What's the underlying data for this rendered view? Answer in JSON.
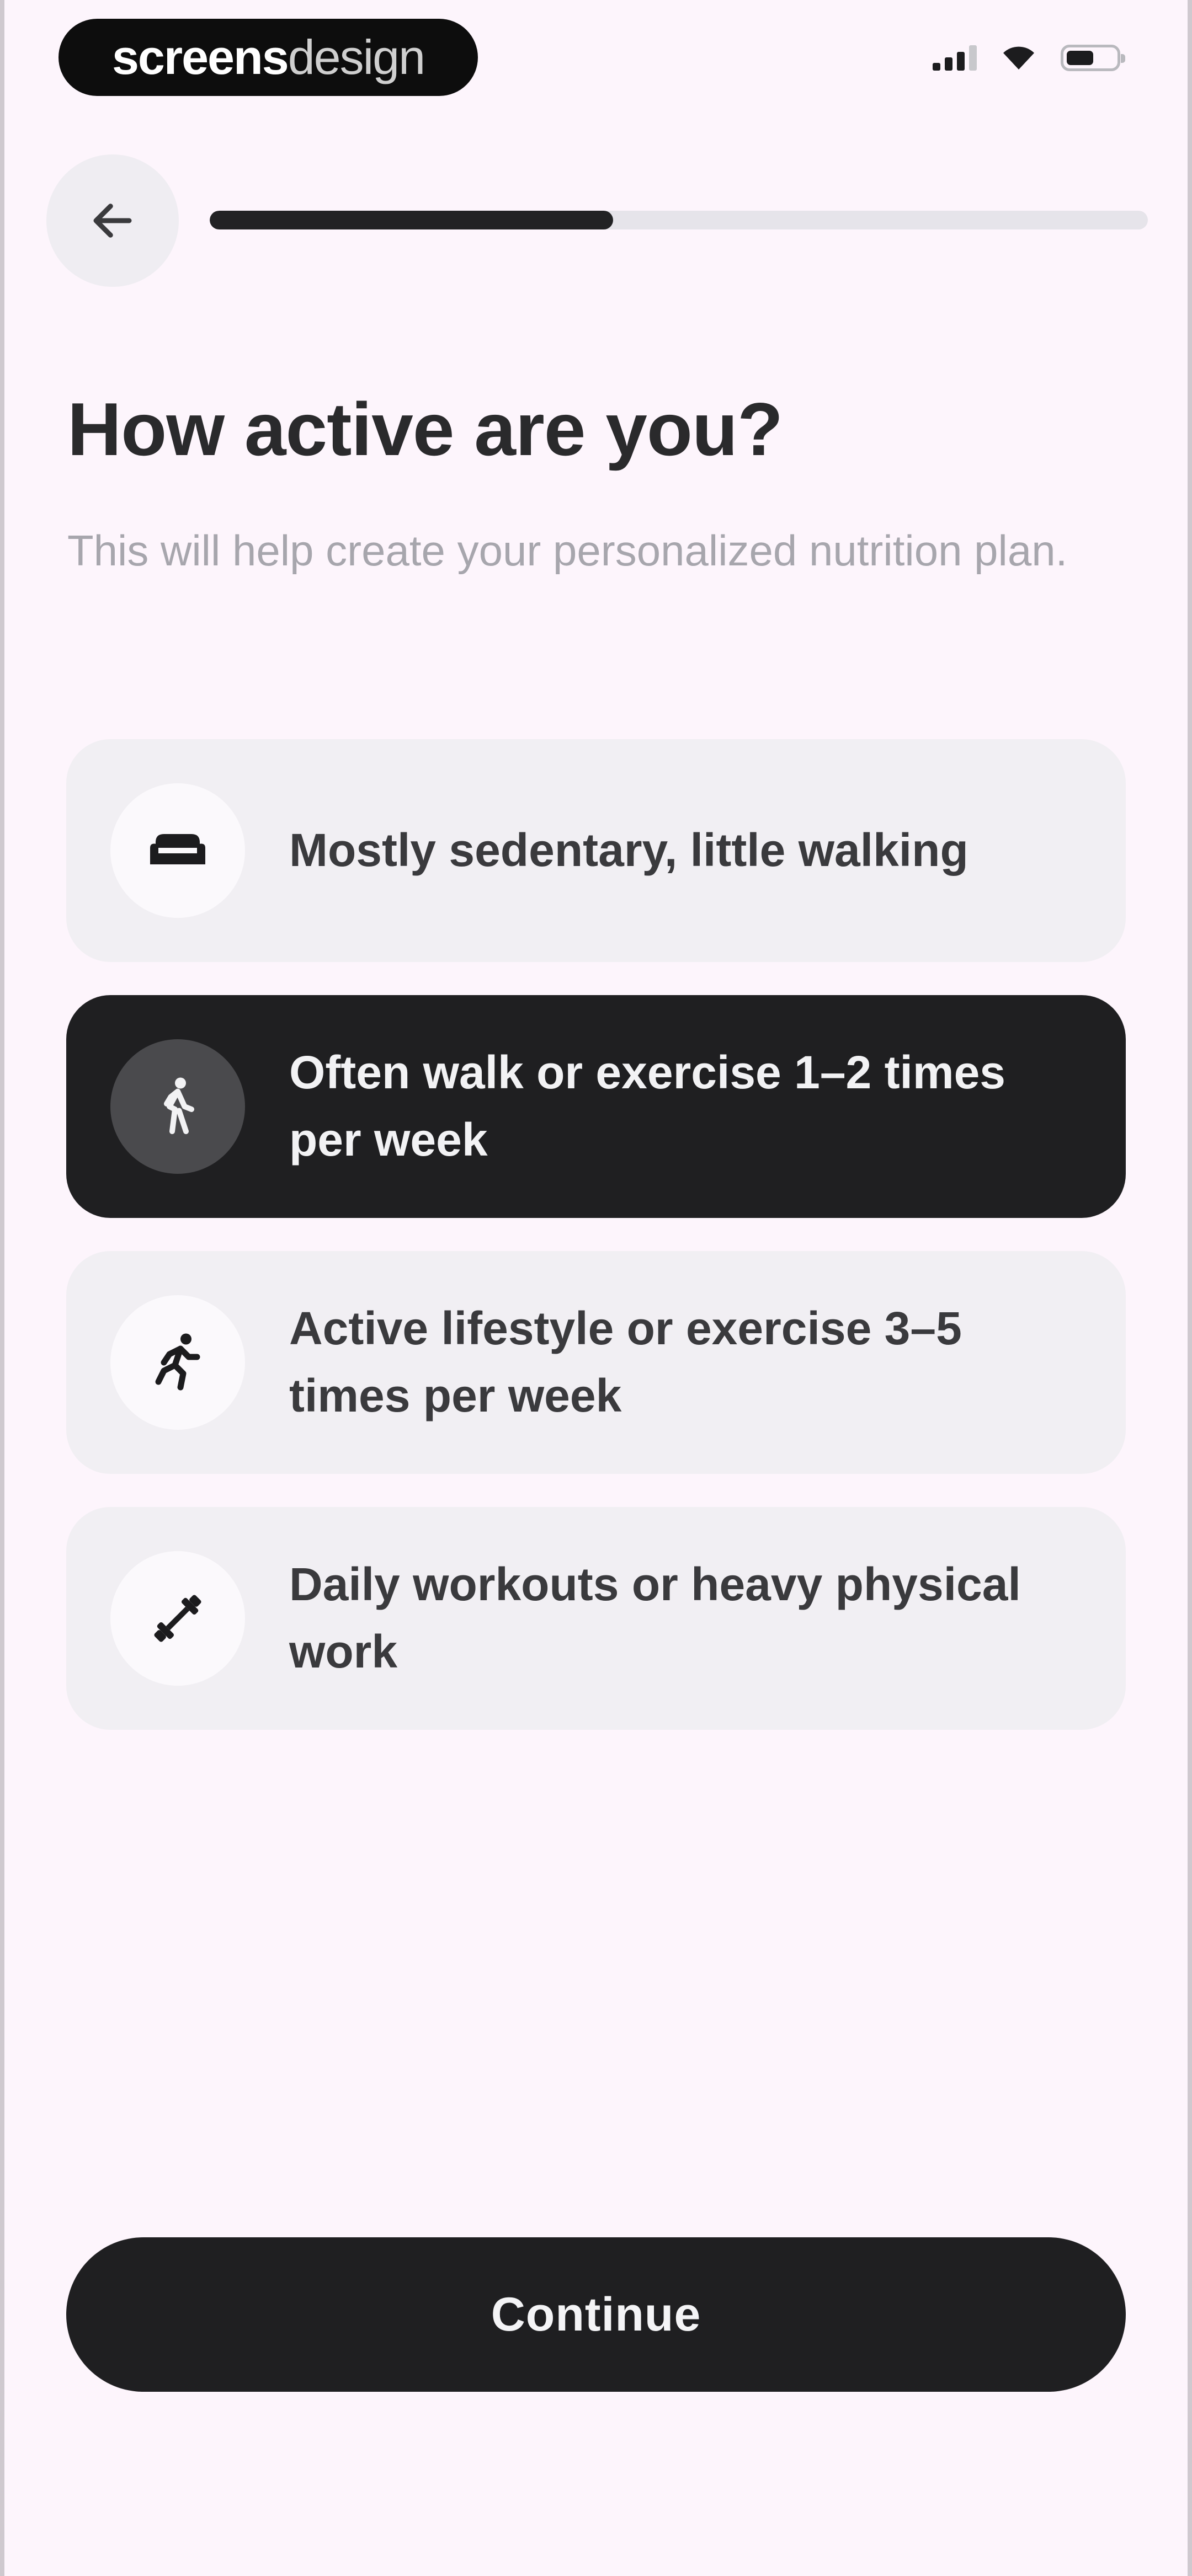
{
  "status_bar": {
    "brand_bold": "screens",
    "brand_light": "design",
    "icons": [
      "signal-icon",
      "wifi-icon",
      "battery-icon"
    ]
  },
  "header": {
    "back_icon": "arrow-left-icon",
    "progress_fraction": 0.43
  },
  "title": "How active are you?",
  "subtitle": "This will help create your personalized nutrition plan.",
  "options": [
    {
      "label": "Mostly sedentary, little walking",
      "icon": "sofa-icon",
      "selected": false
    },
    {
      "label": "Often walk or exercise 1–2 times per week",
      "icon": "walking-icon",
      "selected": true
    },
    {
      "label": "Active lifestyle or exercise 3–5 times per week",
      "icon": "running-icon",
      "selected": false
    },
    {
      "label": "Daily workouts or heavy physical work",
      "icon": "dumbbell-icon",
      "selected": false
    }
  ],
  "continue_label": "Continue",
  "colors": {
    "background": "#fdf5fc",
    "accent_dark": "#1f1f21",
    "option_bg": "#f1eff3",
    "subtitle_gray": "#a7a6ad"
  }
}
